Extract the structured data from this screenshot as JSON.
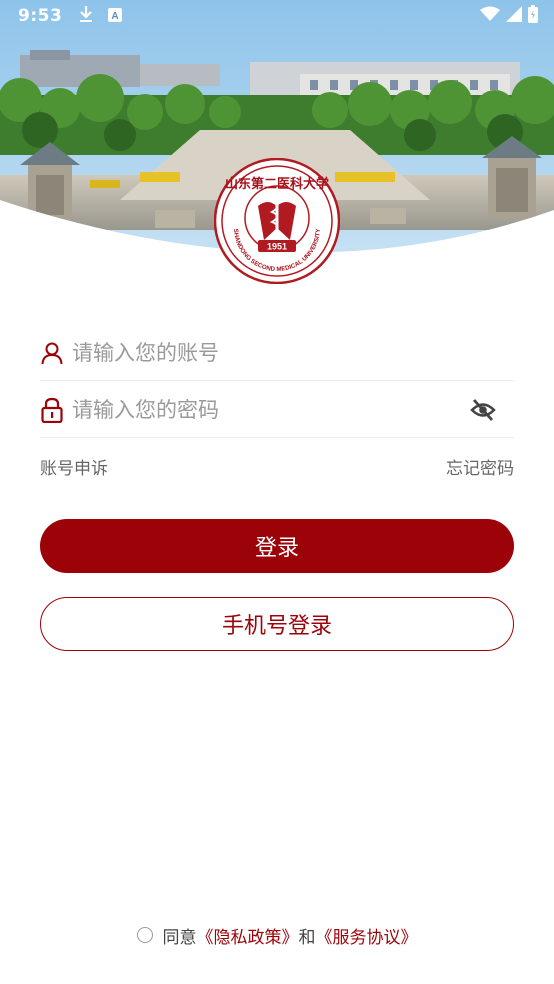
{
  "status_bar": {
    "time": "9:53",
    "icons": [
      "download-icon",
      "font-a-icon",
      "wifi-icon",
      "signal-icon",
      "battery-icon"
    ]
  },
  "logo": {
    "name": "Shandong Second Medical University emblem",
    "year": "1951",
    "ring_text": "SHANDONG SECOND MEDICAL UNIVERSITY",
    "calligraphy": "山东第二医科大学"
  },
  "form": {
    "account_placeholder": "请输入您的账号",
    "password_placeholder": "请输入您的密码"
  },
  "links": {
    "appeal": "账号申诉",
    "forgot": "忘记密码"
  },
  "buttons": {
    "login": "登录",
    "phone_login": "手机号登录"
  },
  "agreement": {
    "prefix": "同意",
    "privacy": "《隐私政策》",
    "and": "和",
    "service": "《服务协议》"
  },
  "colors": {
    "brand": "#9c0309",
    "placeholder": "#9a9a9a",
    "divider": "#ececec"
  }
}
